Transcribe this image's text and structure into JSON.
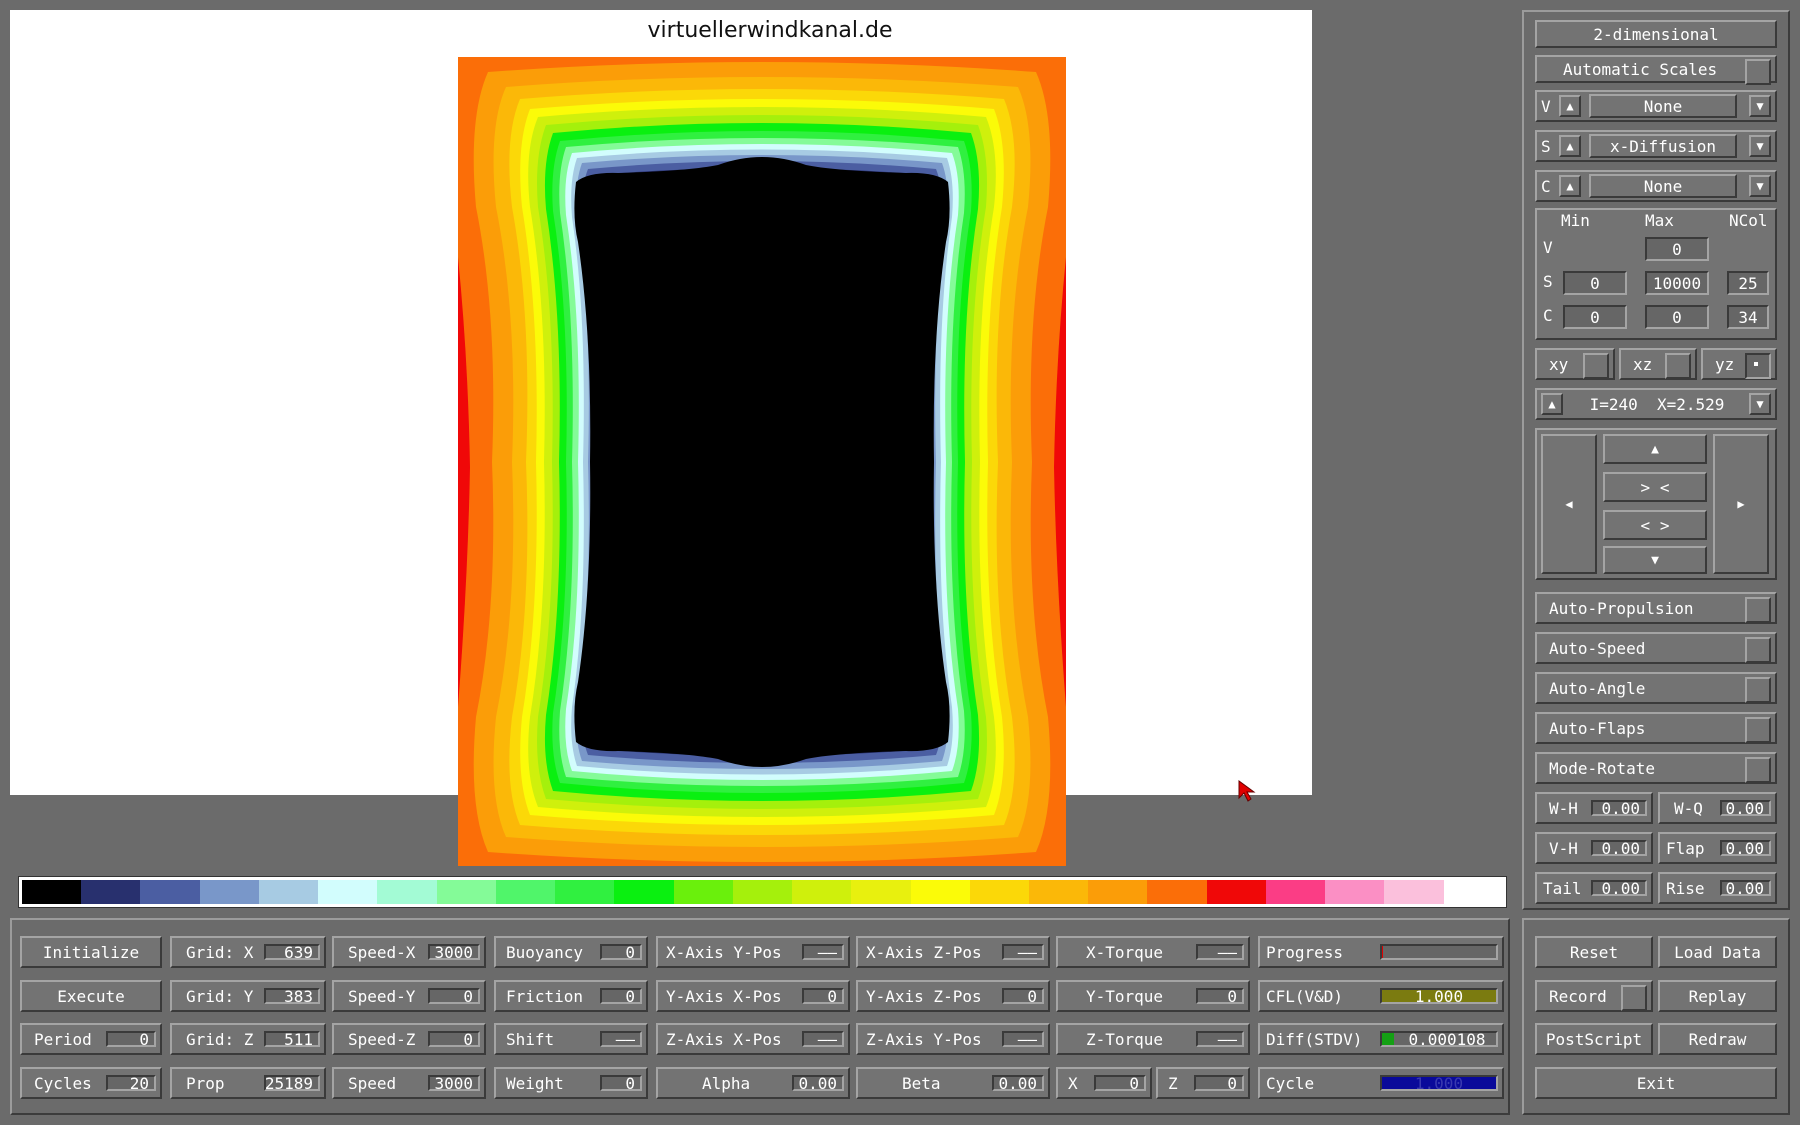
{
  "canvas": {
    "title": "virtuellerwindkanal.de"
  },
  "colorscale": [
    "#000000",
    "#28306e",
    "#4b5ea2",
    "#7997c9",
    "#a7cbe3",
    "#d2fdfd",
    "#a3fbd5",
    "#84fb98",
    "#50f56a",
    "#30f040",
    "#0af010",
    "#6af00c",
    "#a5f00c",
    "#cff00c",
    "#e8f00e",
    "#fbfb08",
    "#fbd808",
    "#fbb808",
    "#fb9d08",
    "#fb6e08",
    "#f00808",
    "#fb3d85",
    "#fb8fc4",
    "#fbc0dc",
    "#ffffff"
  ],
  "sidebar": {
    "mode_label": "2-dimensional",
    "auto_scales": "Automatic Scales",
    "rows": [
      {
        "letter": "V",
        "value": "None"
      },
      {
        "letter": "S",
        "value": "x-Diffusion"
      },
      {
        "letter": "C",
        "value": "None"
      }
    ],
    "headers": {
      "min": "Min",
      "max": "Max",
      "ncol": "NCol"
    },
    "ranges": [
      {
        "letter": "V",
        "max": "0"
      },
      {
        "letter": "S",
        "min": "0",
        "max": "10000",
        "ncol": "25"
      },
      {
        "letter": "C",
        "min": "0",
        "max": "0",
        "ncol": "34"
      }
    ],
    "planes": [
      "xy",
      "xz",
      "yz"
    ],
    "slice_label": "I=240  X=2.529",
    "nav": {
      "up": "▲",
      "in": "> <",
      "out": "< >",
      "down": "▼",
      "left": "◀",
      "right": "▶"
    },
    "toggles": [
      "Auto-Propulsion",
      "Auto-Speed",
      "Auto-Angle",
      "Auto-Flaps",
      "Mode-Rotate"
    ],
    "params": [
      {
        "label": "W-H",
        "value": "0.00"
      },
      {
        "label": "W-Q",
        "value": "0.00"
      },
      {
        "label": "V-H",
        "value": "0.00"
      },
      {
        "label": "Flap",
        "value": "0.00"
      },
      {
        "label": "Tail",
        "value": "0.00"
      },
      {
        "label": "Rise",
        "value": "0.00"
      }
    ],
    "arrows": {
      "up": "▲",
      "down": "▼"
    }
  },
  "bottom": {
    "initialize": "Initialize",
    "execute": "Execute",
    "period": {
      "label": "Period",
      "value": "0"
    },
    "cycles": {
      "label": "Cycles",
      "value": "20"
    },
    "grid_x": {
      "label": "Grid: X",
      "value": "639"
    },
    "grid_y": {
      "label": "Grid: Y",
      "value": "383"
    },
    "grid_z": {
      "label": "Grid: Z",
      "value": "511"
    },
    "prop": {
      "label": "Prop",
      "value": "25189"
    },
    "speed_x": {
      "label": "Speed-X",
      "value": "3000"
    },
    "speed_y": {
      "label": "Speed-Y",
      "value": "0"
    },
    "speed_z": {
      "label": "Speed-Z",
      "value": "0"
    },
    "speed": {
      "label": "Speed",
      "value": "3000"
    },
    "buoyancy": {
      "label": "Buoyancy",
      "value": "0"
    },
    "friction": {
      "label": "Friction",
      "value": "0"
    },
    "shift": {
      "label": "Shift",
      "value": "——"
    },
    "weight": {
      "label": "Weight",
      "value": "0"
    },
    "xaxis_ypos": {
      "label": "X-Axis Y-Pos",
      "value": "——"
    },
    "yaxis_xpos": {
      "label": "Y-Axis X-Pos",
      "value": "0"
    },
    "zaxis_xpos": {
      "label": "Z-Axis X-Pos",
      "value": "——"
    },
    "alpha": {
      "label": "Alpha",
      "value": "0.00"
    },
    "xaxis_zpos": {
      "label": "X-Axis Z-Pos",
      "value": "——"
    },
    "yaxis_zpos": {
      "label": "Y-Axis Z-Pos",
      "value": "0"
    },
    "zaxis_ypos": {
      "label": "Z-Axis Y-Pos",
      "value": "——"
    },
    "beta": {
      "label": "Beta",
      "value": "0.00"
    },
    "x_torque": {
      "label": "X-Torque",
      "value": "——"
    },
    "y_torque": {
      "label": "Y-Torque",
      "value": "0"
    },
    "z_torque": {
      "label": "Z-Torque",
      "value": "——"
    },
    "x": {
      "label": "X",
      "value": "0"
    },
    "z": {
      "label": "Z",
      "value": "0"
    },
    "progress": {
      "label": "Progress",
      "fraction": 0.01
    },
    "cfl": {
      "label": "CFL(V&D)",
      "value": "1.000",
      "color": "#7b7b10"
    },
    "diff": {
      "label": "Diff(STDV)",
      "value": "0.000108",
      "color": "#14a014"
    },
    "cycle": {
      "label": "Cycle",
      "value": "1.000",
      "color": "#0a0a9a"
    },
    "reset": "Reset",
    "load_data": "Load Data",
    "record": "Record",
    "replay": "Replay",
    "postscript": "PostScript",
    "redraw": "Redraw",
    "exit": "Exit"
  }
}
